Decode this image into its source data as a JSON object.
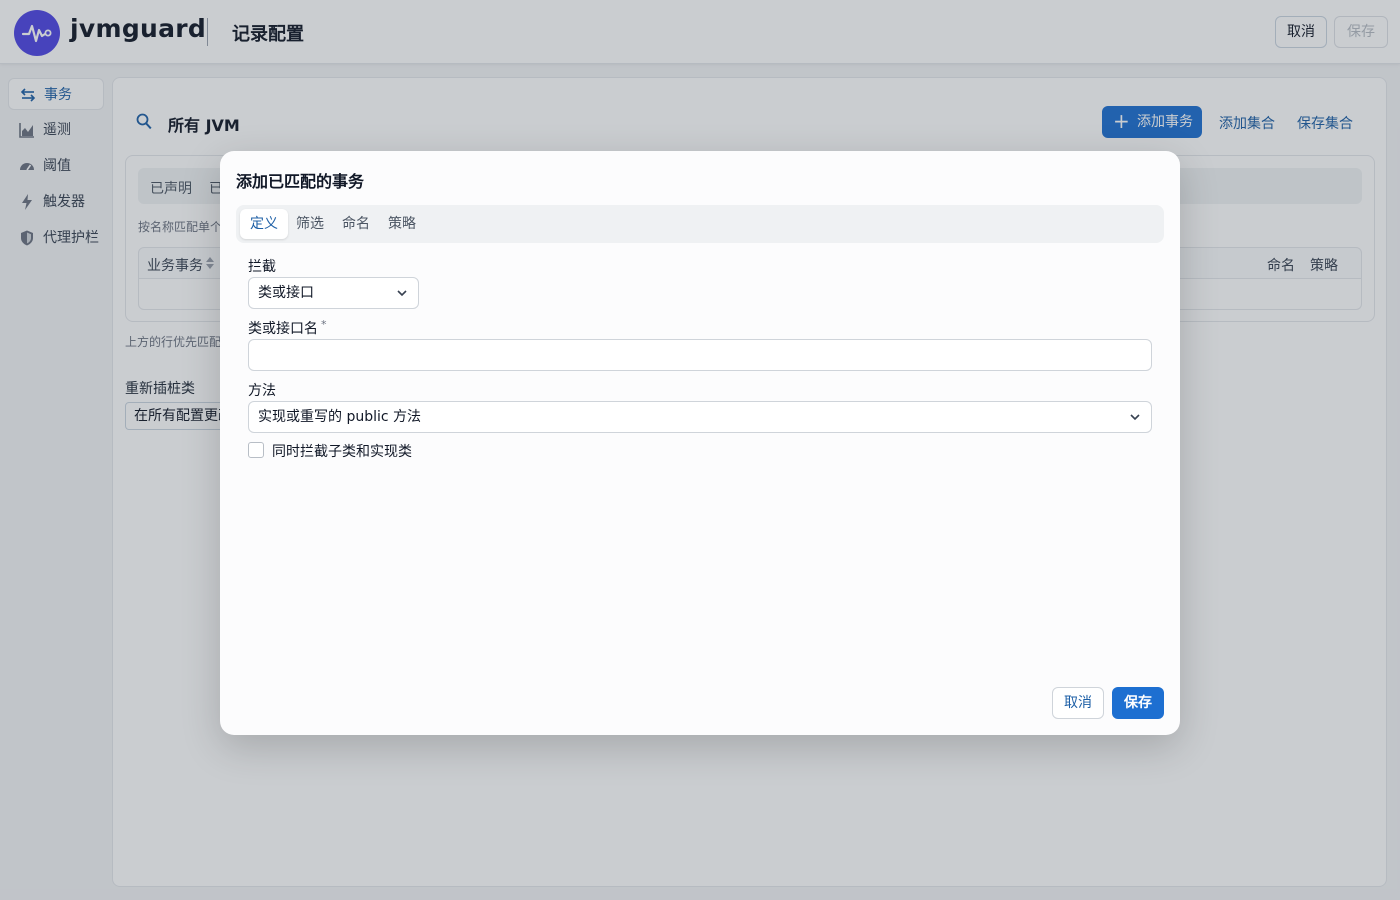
{
  "header": {
    "brand": "jvmguard",
    "title": "记录配置",
    "cancel_label": "取消",
    "save_label": "保存"
  },
  "sidebar": {
    "items": [
      {
        "label": "事务",
        "icon": "arrows-icon",
        "active": true
      },
      {
        "label": "遥测",
        "icon": "chart-icon"
      },
      {
        "label": "阈值",
        "icon": "gauge-icon"
      },
      {
        "label": "触发器",
        "icon": "bolt-icon"
      },
      {
        "label": "代理护栏",
        "icon": "shield-icon"
      }
    ]
  },
  "main": {
    "scope": "所有 JVM",
    "add_transaction": "添加事务",
    "add_set": "添加集合",
    "save_set": "保存集合",
    "segments": [
      "已声明",
      "已"
    ],
    "hint": "按名称匹配单个方",
    "table_headers": {
      "business": "业务事务",
      "naming": "命名",
      "policy": "策略"
    },
    "bottom_hint": "上方的行优先匹配。",
    "retransform_label": "重新插桩类",
    "retransform_value": "在所有配置更改"
  },
  "modal": {
    "title": "添加已匹配的事务",
    "tabs": [
      "定义",
      "筛选",
      "命名",
      "策略"
    ],
    "active_tab": "定义",
    "intercept_label": "拦截",
    "intercept_value": "类或接口",
    "class_label": "类或接口名",
    "required_mark": "*",
    "class_value": "",
    "method_label": "方法",
    "method_value": "实现或重写的 public 方法",
    "subclass_checkbox": "同时拦截子类和实现类",
    "subclass_checked": false,
    "cancel_label": "取消",
    "save_label": "保存"
  },
  "colors": {
    "primary": "#1d6fd1",
    "link": "#1d5fa6",
    "logo": "#4f46e5"
  }
}
